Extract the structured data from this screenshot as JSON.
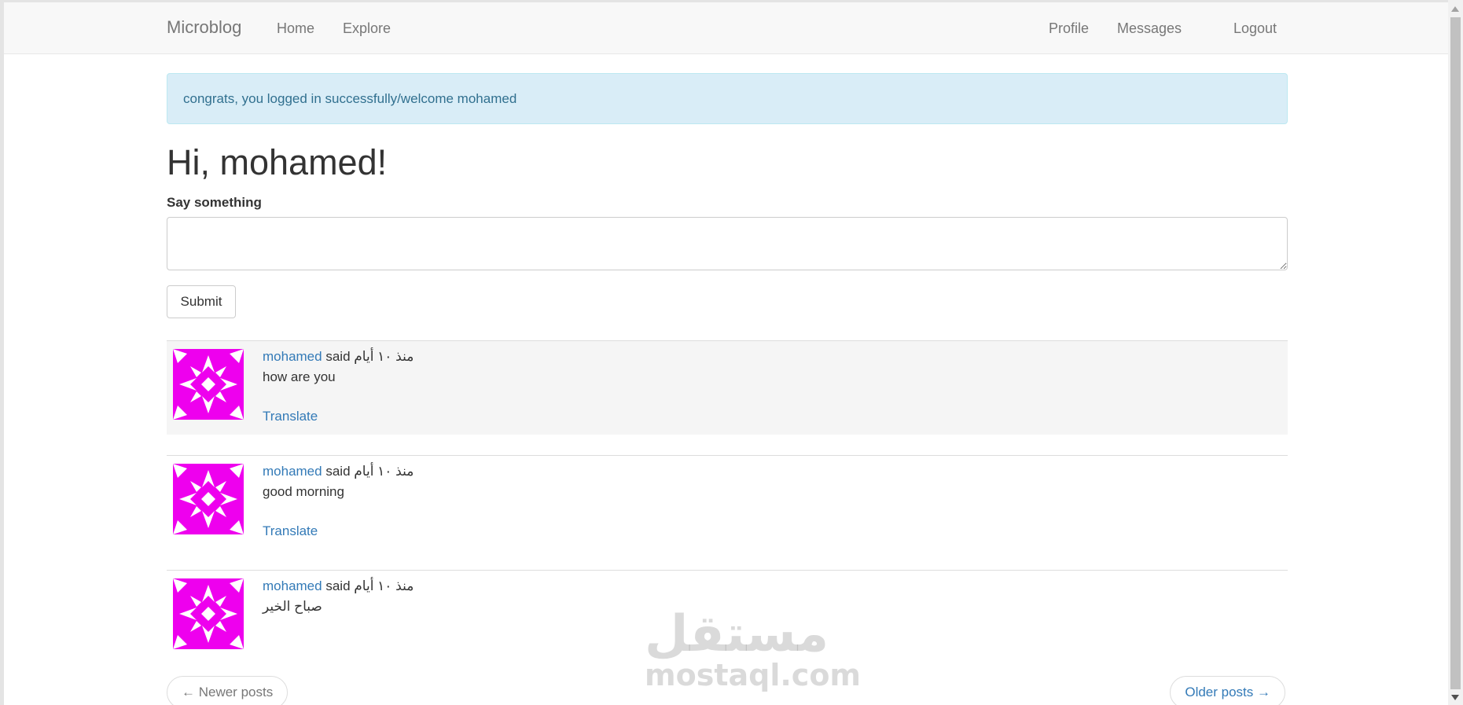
{
  "nav": {
    "brand": "Microblog",
    "home": "Home",
    "explore": "Explore",
    "profile": "Profile",
    "messages": "Messages",
    "logout": "Logout"
  },
  "alert": {
    "text": "congrats, you logged in successfully/welcome mohamed"
  },
  "greeting": "Hi, mohamed!",
  "form": {
    "label": "Say something",
    "value": "",
    "submit_label": "Submit"
  },
  "posts": [
    {
      "author": "mohamed",
      "said": "said",
      "time": "منذ ١٠ أيام",
      "body": "how are you",
      "translate": "Translate"
    },
    {
      "author": "mohamed",
      "said": "said",
      "time": "منذ ١٠ أيام",
      "body": "good morning",
      "translate": "Translate"
    },
    {
      "author": "mohamed",
      "said": "said",
      "time": "منذ ١٠ أيام",
      "body": "صباح الخير",
      "translate": ""
    }
  ],
  "pager": {
    "newer": "← Newer posts",
    "older": "Older posts →"
  },
  "watermark": {
    "arabic": "مستقل",
    "latin": "mostaql.com"
  },
  "colors": {
    "avatar": "#ee00ee",
    "link": "#337ab7",
    "alert_bg": "#d9edf7"
  }
}
